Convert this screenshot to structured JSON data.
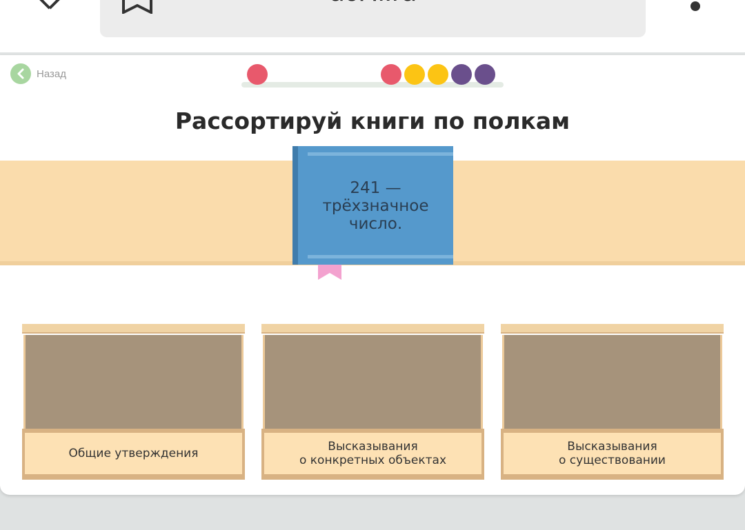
{
  "browser": {
    "url": "ucHi.ru",
    "icons": [
      "close-icon",
      "bookmark-icon",
      "menu-dots-icon"
    ]
  },
  "nav": {
    "back_label": "Назад",
    "back_icon": "chevron-left-icon"
  },
  "progress": {
    "dots": [
      "#e8596c",
      "#e8596c",
      "#fcc414",
      "#fcc414",
      "#6a4f8c",
      "#6a4f8c"
    ]
  },
  "task": {
    "title": "Рассортируй книги по полкам"
  },
  "book": {
    "text": "241 — трёхзначное число.",
    "color": "#5599cc"
  },
  "shelves": [
    {
      "label": "Общие утверждения"
    },
    {
      "label": "Высказывания\nо конкретных объектах"
    },
    {
      "label": "Высказывания\nо существовании"
    }
  ]
}
